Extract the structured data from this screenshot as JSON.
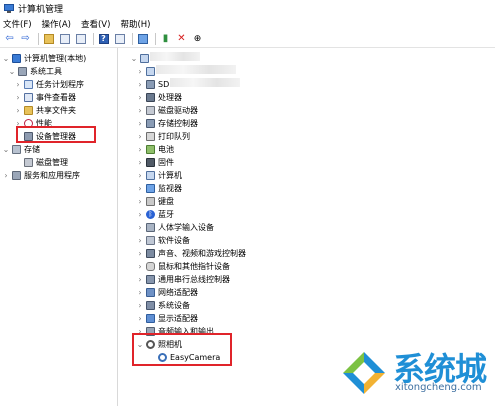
{
  "window": {
    "title": "计算机管理"
  },
  "menu": [
    "文件(F)",
    "操作(A)",
    "查看(V)",
    "帮助(H)"
  ],
  "left_tree": [
    {
      "label": "计算机管理(本地)",
      "chev": "⌄",
      "icon": "mgmt"
    },
    {
      "label": "系统工具",
      "chev": "⌄",
      "icon": "tools"
    },
    {
      "label": "任务计划程序",
      "chev": "›",
      "icon": "sched"
    },
    {
      "label": "事件查看器",
      "chev": "›",
      "icon": "event"
    },
    {
      "label": "共享文件夹",
      "chev": "›",
      "icon": "folder"
    },
    {
      "label": "性能",
      "chev": "›",
      "icon": "perf"
    },
    {
      "label": "设备管理器",
      "chev": "",
      "icon": "devmgr"
    },
    {
      "label": "存储",
      "chev": "⌄",
      "icon": "store"
    },
    {
      "label": "磁盘管理",
      "chev": "",
      "icon": "disk"
    },
    {
      "label": "服务和应用程序",
      "chev": "›",
      "icon": "svc"
    }
  ],
  "device_tree": [
    {
      "label": "",
      "chev": "⌄",
      "icon": "pc"
    },
    {
      "label": "",
      "chev": "›",
      "icon": "pc"
    },
    {
      "label": "SD",
      "chev": "›",
      "icon": "chip"
    },
    {
      "label": "处理器",
      "chev": "›",
      "icon": "cpu"
    },
    {
      "label": "磁盘驱动器",
      "chev": "›",
      "icon": "disk"
    },
    {
      "label": "存储控制器",
      "chev": "›",
      "icon": "chip"
    },
    {
      "label": "打印队列",
      "chev": "›",
      "icon": "printer"
    },
    {
      "label": "电池",
      "chev": "›",
      "icon": "battery"
    },
    {
      "label": "固件",
      "chev": "›",
      "icon": "firmware"
    },
    {
      "label": "计算机",
      "chev": "›",
      "icon": "pc"
    },
    {
      "label": "监视器",
      "chev": "›",
      "icon": "monitor"
    },
    {
      "label": "键盘",
      "chev": "›",
      "icon": "keyboard"
    },
    {
      "label": "蓝牙",
      "chev": "›",
      "icon": "bt"
    },
    {
      "label": "人体学输入设备",
      "chev": "›",
      "icon": "hid"
    },
    {
      "label": "软件设备",
      "chev": "›",
      "icon": "sw"
    },
    {
      "label": "声音、视频和游戏控制器",
      "chev": "›",
      "icon": "audio"
    },
    {
      "label": "鼠标和其他指针设备",
      "chev": "›",
      "icon": "mouse"
    },
    {
      "label": "通用串行总线控制器",
      "chev": "›",
      "icon": "usb"
    },
    {
      "label": "网络适配器",
      "chev": "›",
      "icon": "net"
    },
    {
      "label": "系统设备",
      "chev": "›",
      "icon": "sys"
    },
    {
      "label": "显示适配器",
      "chev": "›",
      "icon": "display"
    },
    {
      "label": "音频输入和输出",
      "chev": "›",
      "icon": "audioio"
    },
    {
      "label": "照相机",
      "chev": "⌄",
      "icon": "camera"
    },
    {
      "label": "EasyCamera",
      "chev": "",
      "icon": "cam2"
    }
  ],
  "watermark": {
    "brand": "系统城",
    "url": "xitongcheng.com"
  },
  "colors": {
    "highlight_box": "#e0242a",
    "brand_blue": "#1f8fd6",
    "brand_green": "#7cc243"
  }
}
